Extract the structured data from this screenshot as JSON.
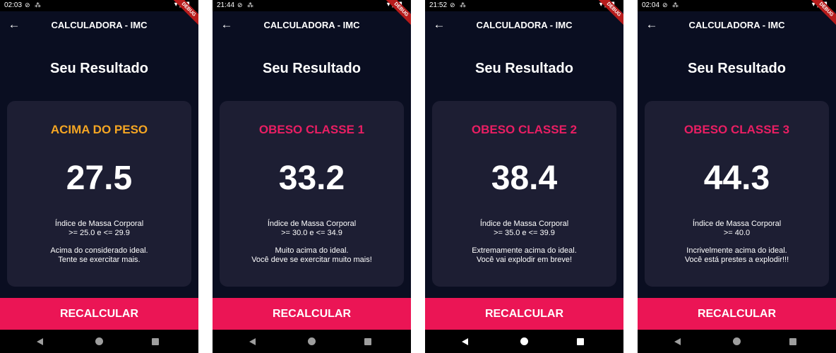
{
  "colors": {
    "background": "#0a0e21",
    "card": "#1d1e33",
    "button": "#eb1555",
    "overweight": "#f5a623",
    "obese": "#e91e63"
  },
  "screens": [
    {
      "status_time": "02:03",
      "app_title": "CALCULADORA - IMC",
      "heading": "Seu Resultado",
      "category": "ACIMA DO PESO",
      "category_color": "#f5a623",
      "bmi": "27.5",
      "description_title": "Índice de Massa Corporal",
      "range": ">= 25.0 e <= 29.9",
      "advice_line1": "Acima do considerado ideal.",
      "advice_line2": "Tente se exercitar mais.",
      "button_label": "RECALCULAR",
      "debug_label": "DEBUG"
    },
    {
      "status_time": "21:44",
      "app_title": "CALCULADORA - IMC",
      "heading": "Seu Resultado",
      "category": "OBESO CLASSE 1",
      "category_color": "#e91e63",
      "bmi": "33.2",
      "description_title": "Índice de Massa Corporal",
      "range": ">= 30.0 e <= 34.9",
      "advice_line1": "Muito acima do ideal.",
      "advice_line2": "Você deve se exercitar muito mais!",
      "button_label": "RECALCULAR",
      "debug_label": "DEBUG"
    },
    {
      "status_time": "21:52",
      "app_title": "CALCULADORA - IMC",
      "heading": "Seu Resultado",
      "category": "OBESO CLASSE 2",
      "category_color": "#e91e63",
      "bmi": "38.4",
      "description_title": "Índice de Massa Corporal",
      "range": ">= 35.0 e <= 39.9",
      "advice_line1": "Extremamente acima do ideal.",
      "advice_line2": "Você vai explodir em breve!",
      "button_label": "RECALCULAR",
      "debug_label": "DEBUG"
    },
    {
      "status_time": "02:04",
      "app_title": "CALCULADORA - IMC",
      "heading": "Seu Resultado",
      "category": "OBESO CLASSE 3",
      "category_color": "#e91e63",
      "bmi": "44.3",
      "description_title": "Índice de Massa Corporal",
      "range": ">= 40.0",
      "advice_line1": "Incrivelmente acima do ideal.",
      "advice_line2": "Você está prestes a explodir!!!",
      "button_label": "RECALCULAR",
      "debug_label": "DEBUG"
    }
  ],
  "icons": {
    "back": "arrow-left-icon",
    "nav_back": "triangle-back-icon",
    "nav_home": "circle-home-icon",
    "nav_recents": "square-recents-icon"
  }
}
